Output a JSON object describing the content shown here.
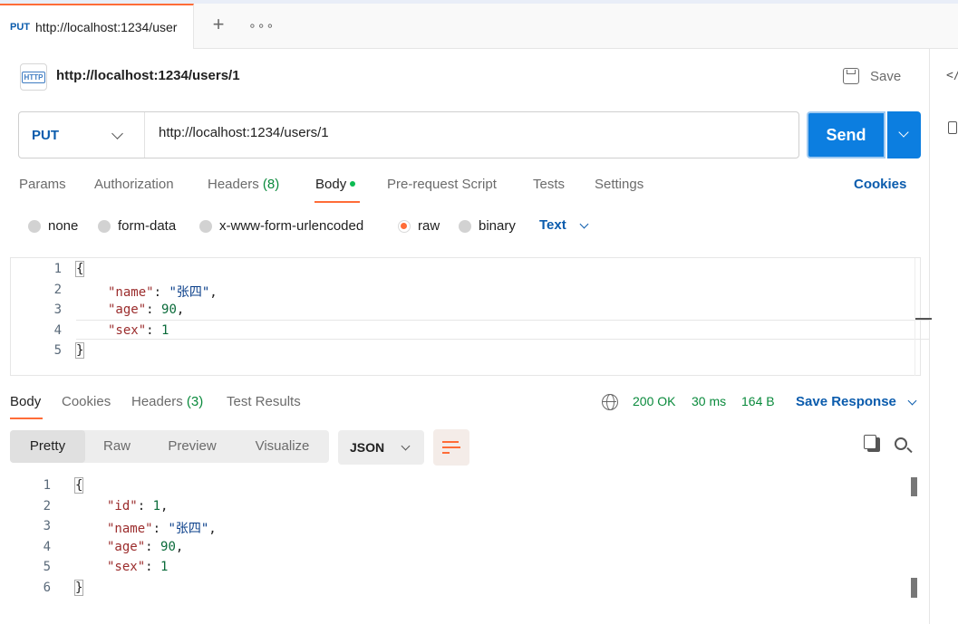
{
  "tab": {
    "method": "PUT",
    "name": "http://localhost:1234/user",
    "new_tab": "+",
    "more": "∘∘∘"
  },
  "request": {
    "icon_label": "HTTP",
    "title": "http://localhost:1234/users/1",
    "save_label": "Save",
    "method": "PUT",
    "url": "http://localhost:1234/users/1",
    "send_label": "Send"
  },
  "request_tabs": {
    "params": "Params",
    "authorization": "Authorization",
    "headers": "Headers",
    "headers_count": "(8)",
    "body": "Body",
    "prerequest": "Pre-request Script",
    "tests": "Tests",
    "settings": "Settings",
    "cookies": "Cookies"
  },
  "body_types": {
    "none": "none",
    "form_data": "form-data",
    "urlencoded": "x-www-form-urlencoded",
    "raw": "raw",
    "binary": "binary",
    "format": "Text"
  },
  "request_body": {
    "line_numbers": [
      "1",
      "2",
      "3",
      "4",
      "5"
    ],
    "open": "{",
    "close": "}",
    "l2_key": "\"name\"",
    "l2_val": "\"张四\"",
    "l3_key": "\"age\"",
    "l3_val": "90",
    "l4_key": "\"sex\"",
    "l4_val": "1"
  },
  "response_tabs": {
    "body": "Body",
    "cookies": "Cookies",
    "headers": "Headers",
    "headers_count": "(3)",
    "test_results": "Test Results"
  },
  "response_status": {
    "status": "200 OK",
    "time": "30 ms",
    "size": "164 B",
    "save_response": "Save Response"
  },
  "response_view": {
    "pretty": "Pretty",
    "raw": "Raw",
    "preview": "Preview",
    "visualize": "Visualize",
    "format": "JSON"
  },
  "response_body": {
    "line_numbers": [
      "1",
      "2",
      "3",
      "4",
      "5",
      "6"
    ],
    "open": "{",
    "close": "}",
    "l2_key": "\"id\"",
    "l2_val": "1",
    "l3_key": "\"name\"",
    "l3_val": "\"张四\"",
    "l4_key": "\"age\"",
    "l4_val": "90",
    "l5_key": "\"sex\"",
    "l5_val": "1"
  },
  "rail": {
    "code_icon_label": "</"
  },
  "colors": {
    "accent": "#ff6c37",
    "primary": "#0c7ee0",
    "link": "#0b5cad",
    "success": "#0a8a3c"
  }
}
